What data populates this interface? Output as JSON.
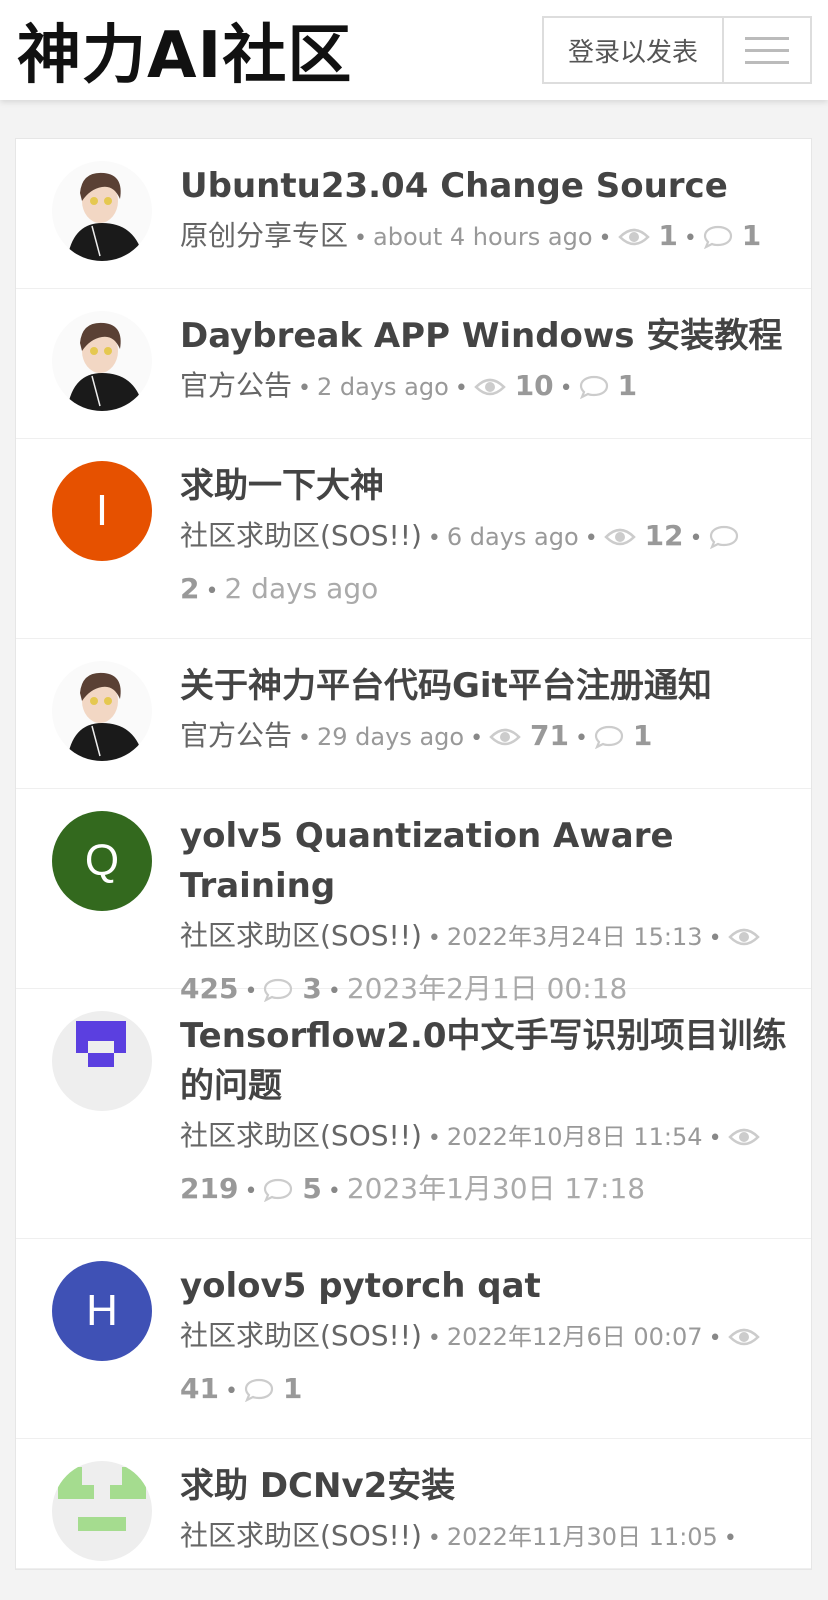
{
  "header": {
    "site_title": "神力AI社区",
    "login_label": "登录以发表"
  },
  "topics": [
    {
      "title": "Ubuntu23.04 Change Source",
      "category": "原创分享专区",
      "time": "about 4 hours ago",
      "views": "1",
      "replies": "1",
      "last": "",
      "avatar": {
        "type": "photo"
      }
    },
    {
      "title": "Daybreak APP Windows 安装教程",
      "category": "官方公告",
      "time": "2 days ago",
      "views": "10",
      "replies": "1",
      "last": "",
      "avatar": {
        "type": "photo"
      }
    },
    {
      "title": "求助一下大神",
      "category": "社区求助区(SOS!!)",
      "time": "6 days ago",
      "views": "12",
      "replies": "2",
      "last": "2 days ago",
      "avatar": {
        "type": "letter",
        "letter": "I",
        "color": "#e65100"
      }
    },
    {
      "title": "关于神力平台代码Git平台注册通知",
      "category": "官方公告",
      "time": "29 days ago",
      "views": "71",
      "replies": "1",
      "last": "",
      "avatar": {
        "type": "photo"
      }
    },
    {
      "title": "yolv5 Quantization Aware Training",
      "category": "社区求助区(SOS!!)",
      "time": "2022年3月24日 15:13",
      "views": "425",
      "replies": "3",
      "last": "2023年2月1日 00:18",
      "avatar": {
        "type": "letter",
        "letter": "Q",
        "color": "#33691e"
      }
    },
    {
      "title": "Tensorflow2.0中文手写识别项目训练的问题",
      "category": "社区求助区(SOS!!)",
      "time": "2022年10月8日 11:54",
      "views": "219",
      "replies": "5",
      "last": "2023年1月30日 17:18",
      "avatar": {
        "type": "identicon",
        "color": "#5b3fe0"
      }
    },
    {
      "title": "yolov5 pytorch qat",
      "category": "社区求助区(SOS!!)",
      "time": "2022年12月6日 00:07",
      "views": "41",
      "replies": "1",
      "last": "",
      "avatar": {
        "type": "letter",
        "letter": "H",
        "color": "#3f51b5"
      }
    },
    {
      "title": "求助 DCNv2安装",
      "category": "社区求助区(SOS!!)",
      "time": "2022年11月30日 11:05",
      "views": "",
      "replies": "",
      "last": "",
      "avatar": {
        "type": "identicon2",
        "color": "#a5dc8f"
      }
    }
  ]
}
